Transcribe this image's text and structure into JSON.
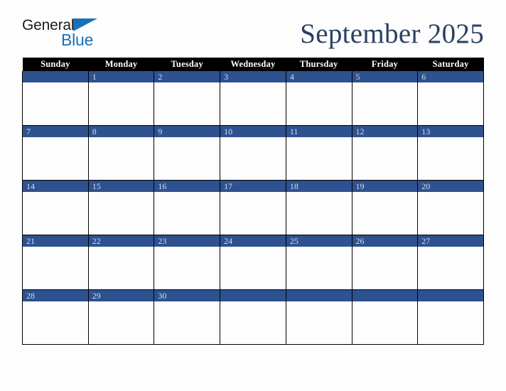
{
  "brand": {
    "name_part1": "General",
    "name_part2": "Blue",
    "triangle_icon": "triangle-icon",
    "accent_color": "#1a70b8",
    "text_color": "#1c1c1c"
  },
  "header": {
    "title": "September 2025",
    "title_color": "#2b3f63"
  },
  "calendar": {
    "month": "September",
    "year": "2025",
    "header_bg": "#000000",
    "header_text_color": "#ffffff",
    "banner_bg": "#2e5190",
    "banner_text_color": "#d9dde6",
    "cell_bg": "#fdfdfd",
    "border_color": "#000000",
    "weekday_headers": [
      "Sunday",
      "Monday",
      "Tuesday",
      "Wednesday",
      "Thursday",
      "Friday",
      "Saturday"
    ],
    "weeks": [
      [
        "",
        "1",
        "2",
        "3",
        "4",
        "5",
        "6"
      ],
      [
        "7",
        "8",
        "9",
        "10",
        "11",
        "12",
        "13"
      ],
      [
        "14",
        "15",
        "16",
        "17",
        "18",
        "19",
        "20"
      ],
      [
        "21",
        "22",
        "23",
        "24",
        "25",
        "26",
        "27"
      ],
      [
        "28",
        "29",
        "30",
        "",
        "",
        "",
        ""
      ]
    ]
  }
}
